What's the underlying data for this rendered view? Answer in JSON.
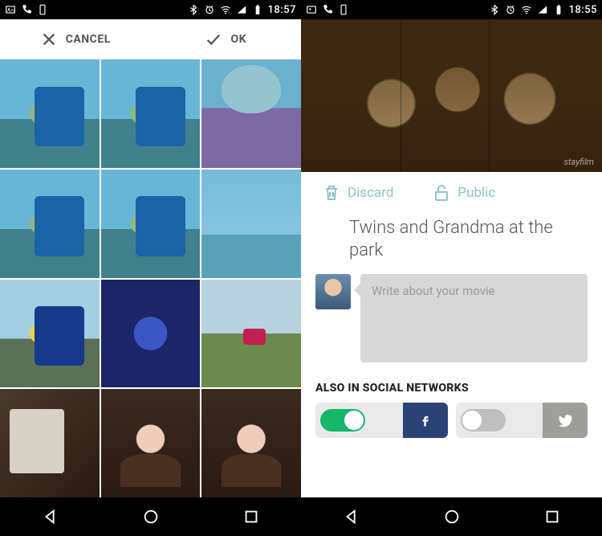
{
  "left": {
    "status": {
      "time": "18:57"
    },
    "toolbar": {
      "cancel": "CANCEL",
      "ok": "OK"
    },
    "grid": {
      "cells": [
        {
          "selected": true
        },
        {
          "selected": true
        },
        {
          "selected": true
        },
        {
          "selected": true
        },
        {
          "selected": true
        },
        {
          "selected": true
        },
        {
          "selected": false
        },
        {
          "selected": false
        },
        {
          "selected": false
        },
        {
          "selected": false
        },
        {
          "selected": false
        },
        {
          "selected": false
        }
      ]
    }
  },
  "right": {
    "status": {
      "time": "18:55"
    },
    "hero": {
      "watermark": "stayfilm"
    },
    "actions": {
      "discard": "Discard",
      "public": "Public"
    },
    "title": "Twins and Grandma at the park",
    "compose": {
      "placeholder": "Write about your movie"
    },
    "social": {
      "header": "ALSO IN SOCIAL NETWORKS",
      "facebook_on": true,
      "twitter_on": false
    }
  }
}
